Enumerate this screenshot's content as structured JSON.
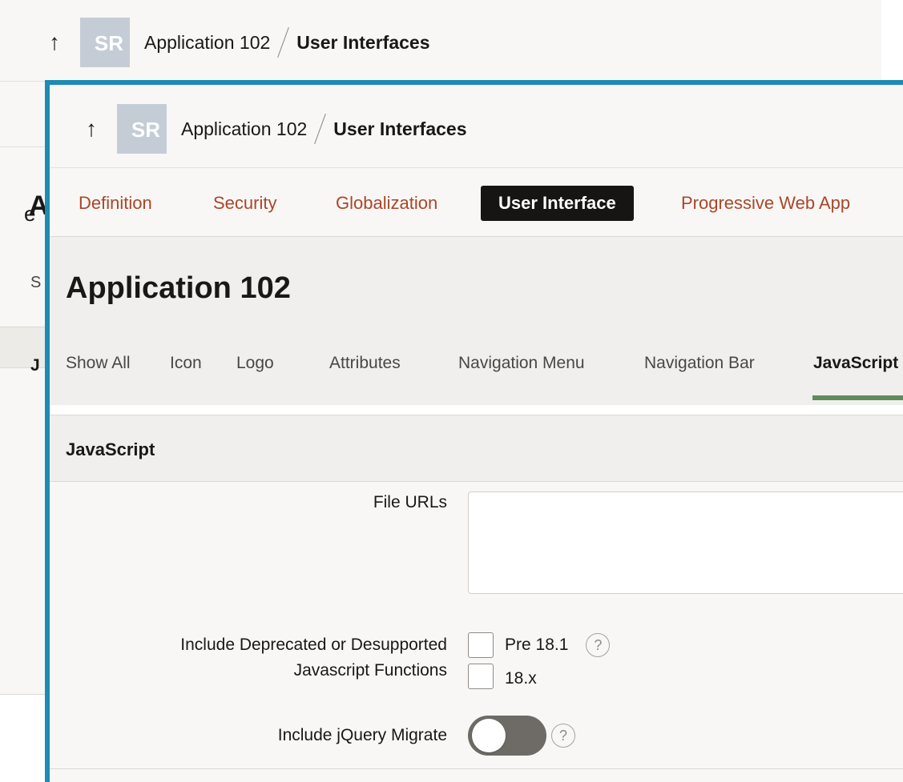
{
  "background_window": {
    "breadcrumb": {
      "up_icon": "↑",
      "avatar": "SR",
      "app": "Application 102",
      "current": "User Interfaces"
    },
    "fragments": {
      "nav_tail": "e",
      "title_initial": "A",
      "subtab_initial": "S",
      "section_initial": "J"
    }
  },
  "window": {
    "breadcrumb": {
      "up_icon": "↑",
      "avatar": "SR",
      "app": "Application 102",
      "current": "User Interfaces"
    },
    "tabs": [
      "Definition",
      "Security",
      "Globalization",
      "User Interface",
      "Progressive Web App"
    ],
    "active_tab": "User Interface",
    "page_title": "Application 102",
    "subtabs": [
      "Show All",
      "Icon",
      "Logo",
      "Attributes",
      "Navigation Menu",
      "Navigation Bar",
      "JavaScript"
    ],
    "active_subtab": "JavaScript",
    "section": {
      "title": "JavaScript",
      "file_urls_label": "File URLs",
      "file_urls_value": "",
      "deprecated_label_line1": "Include Deprecated or Desupported",
      "deprecated_label_line2": "Javascript Functions",
      "options": [
        "Pre 18.1",
        "18.x"
      ],
      "help_glyph": "?",
      "jquery_migrate_label": "Include jQuery Migrate",
      "jquery_migrate_on": false
    }
  },
  "colors": {
    "accent_border": "#1d8bb3",
    "tab_text": "#a9472a",
    "active_tab_bg": "#161513",
    "subtab_underline": "#5e8c5b"
  }
}
